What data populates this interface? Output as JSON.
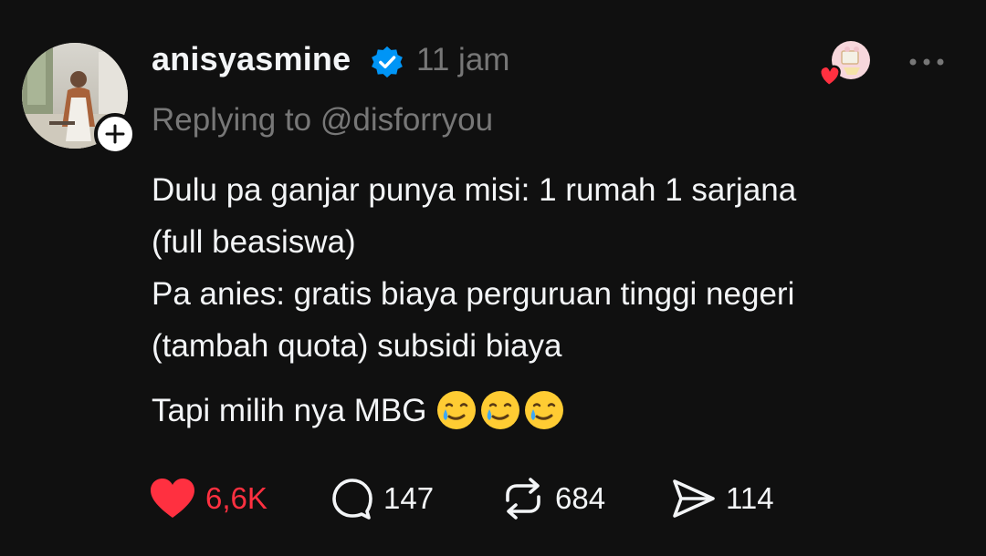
{
  "post": {
    "username": "anisyasmine",
    "time": "11 jam",
    "reply_prefix": "Replying to",
    "reply_mention": "@disforryou",
    "body_lines": [
      "Dulu pa ganjar punya misi: 1 rumah 1 sarjana",
      "(full beasiswa)",
      "Pa anies: gratis biaya perguruan tinggi negeri",
      "(tambah quota) subsidi biaya"
    ],
    "closing_line": "Tapi milih nya MBG",
    "closing_emojis": [
      "smiling-face-with-tear-icon",
      "smiling-face-with-tear-icon",
      "smiling-face-with-tear-icon"
    ]
  },
  "actions": {
    "likes": "6,6K",
    "replies": "147",
    "reposts": "684",
    "shares": "114"
  },
  "colors": {
    "background": "#101010",
    "text": "#f3f5f7",
    "muted": "#777777",
    "like": "#ff3040",
    "verified": "#0095f6"
  }
}
